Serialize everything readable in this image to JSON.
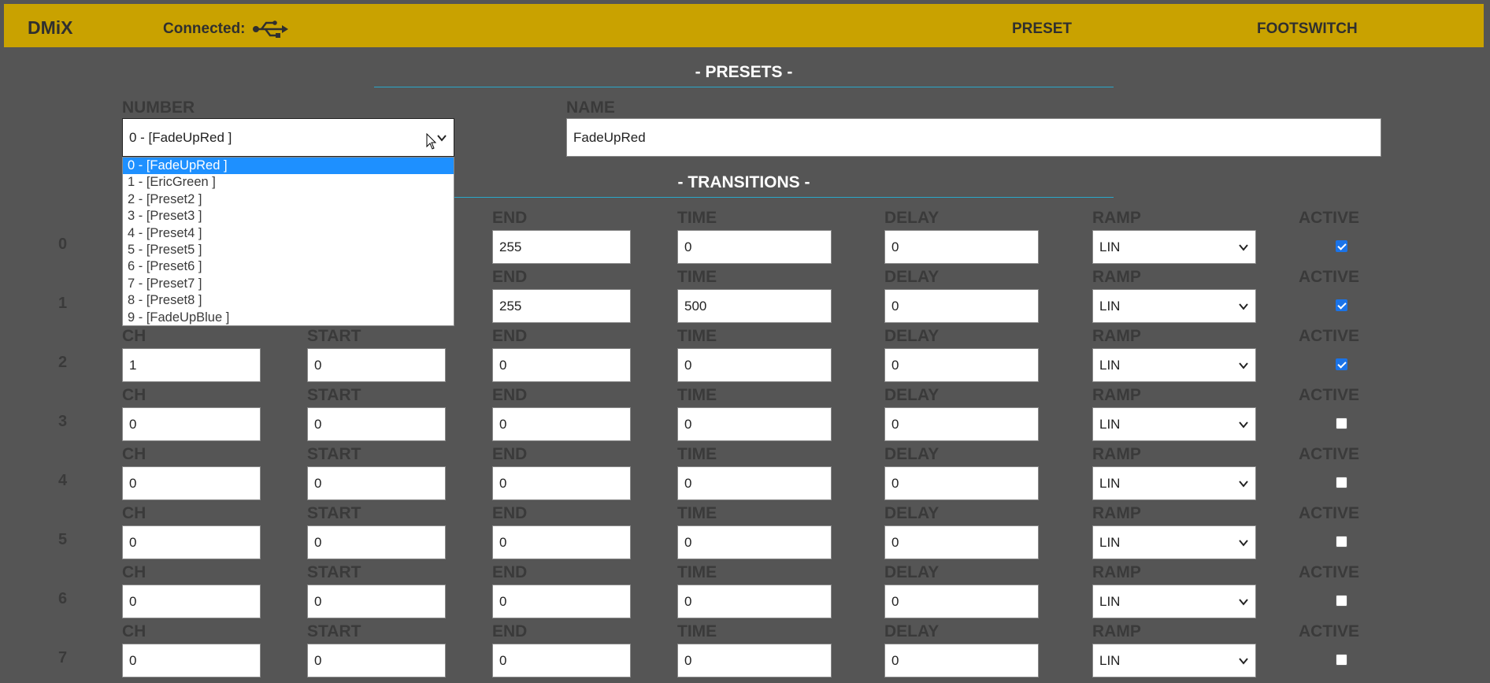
{
  "header": {
    "brand": "DMiX",
    "connected_label": "Connected:",
    "nav_preset": "PRESET",
    "nav_footswitch": "FOOTSWITCH",
    "bar_color": "#c9a200",
    "usb_icon": "usb-icon"
  },
  "presets_section": {
    "title": "- PRESETS -",
    "number_label": "NUMBER",
    "name_label": "NAME",
    "selected_number": "0 - [FadeUpRed ]",
    "name_value": "FadeUpRed",
    "options": [
      "0 - [FadeUpRed ]",
      "1 - [EricGreen ]",
      "2 - [Preset2 ]",
      "3 - [Preset3 ]",
      "4 - [Preset4 ]",
      "5 - [Preset5 ]",
      "6 - [Preset6 ]",
      "7 - [Preset7 ]",
      "8 - [Preset8 ]",
      "9 - [FadeUpBlue ]"
    ]
  },
  "transitions_section": {
    "title": "- TRANSITIONS -",
    "col_labels": {
      "ch": "CH",
      "start": "START",
      "end": "END",
      "time": "TIME",
      "delay": "DELAY",
      "ramp": "RAMP",
      "active": "ACTIVE"
    },
    "rows": [
      {
        "num": "0",
        "ch": "",
        "start": "",
        "end": "255",
        "time": "0",
        "delay": "0",
        "ramp": "LIN",
        "active": true
      },
      {
        "num": "1",
        "ch": "",
        "start": "",
        "end": "255",
        "time": "500",
        "delay": "0",
        "ramp": "LIN",
        "active": true
      },
      {
        "num": "2",
        "ch": "1",
        "start": "0",
        "end": "0",
        "time": "0",
        "delay": "0",
        "ramp": "LIN",
        "active": true
      },
      {
        "num": "3",
        "ch": "0",
        "start": "0",
        "end": "0",
        "time": "0",
        "delay": "0",
        "ramp": "LIN",
        "active": false
      },
      {
        "num": "4",
        "ch": "0",
        "start": "0",
        "end": "0",
        "time": "0",
        "delay": "0",
        "ramp": "LIN",
        "active": false
      },
      {
        "num": "5",
        "ch": "0",
        "start": "0",
        "end": "0",
        "time": "0",
        "delay": "0",
        "ramp": "LIN",
        "active": false
      },
      {
        "num": "6",
        "ch": "0",
        "start": "0",
        "end": "0",
        "time": "0",
        "delay": "0",
        "ramp": "LIN",
        "active": false
      },
      {
        "num": "7",
        "ch": "0",
        "start": "0",
        "end": "0",
        "time": "0",
        "delay": "0",
        "ramp": "LIN",
        "active": false
      }
    ]
  },
  "colors": {
    "background": "#555555",
    "accent_line": "#2aa7c9",
    "checkbox_on": "#1a73e8",
    "dropdown_selected": "#1e90ff"
  }
}
